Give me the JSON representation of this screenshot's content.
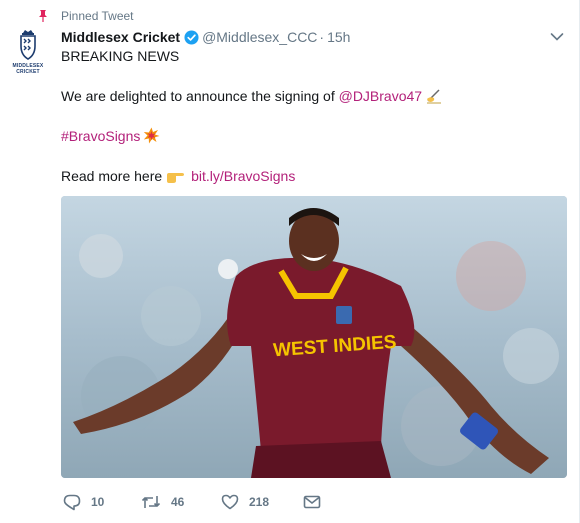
{
  "pinned": {
    "label": "Pinned Tweet",
    "icon": "pin-icon",
    "color": "#e0245e"
  },
  "avatar": {
    "alt_lines": [
      "MIDDLESEX",
      "CRICKET"
    ],
    "brand_color": "#1d3c6e"
  },
  "tweet": {
    "display_name": "Middlesex Cricket",
    "verified": true,
    "handle": "@Middlesex_CCC",
    "separator": "·",
    "time": "15h",
    "line1": "BREAKING NEWS",
    "line2_text": "We are delighted to announce the signing of ",
    "line2_mention": "@DJBravo47",
    "line2_emoji": "writing-hand-emoji",
    "hashtag": "#BravoSigns",
    "hashtag_emoji": "collision-emoji",
    "line4_text": "Read more here ",
    "line4_emoji": "pointing-right-emoji",
    "line4_link": "bit.ly/BravoSigns",
    "link_color": "#b3217a",
    "media": {
      "jersey_text": "WEST INDIES",
      "description_icon": "cricket-player-photo"
    }
  },
  "actions": {
    "replies": "10",
    "retweets": "46",
    "likes": "218",
    "dm_icon": "envelope-icon"
  },
  "colors": {
    "text": "#14171a",
    "muted": "#657786",
    "verified_blue": "#1da1f2"
  }
}
